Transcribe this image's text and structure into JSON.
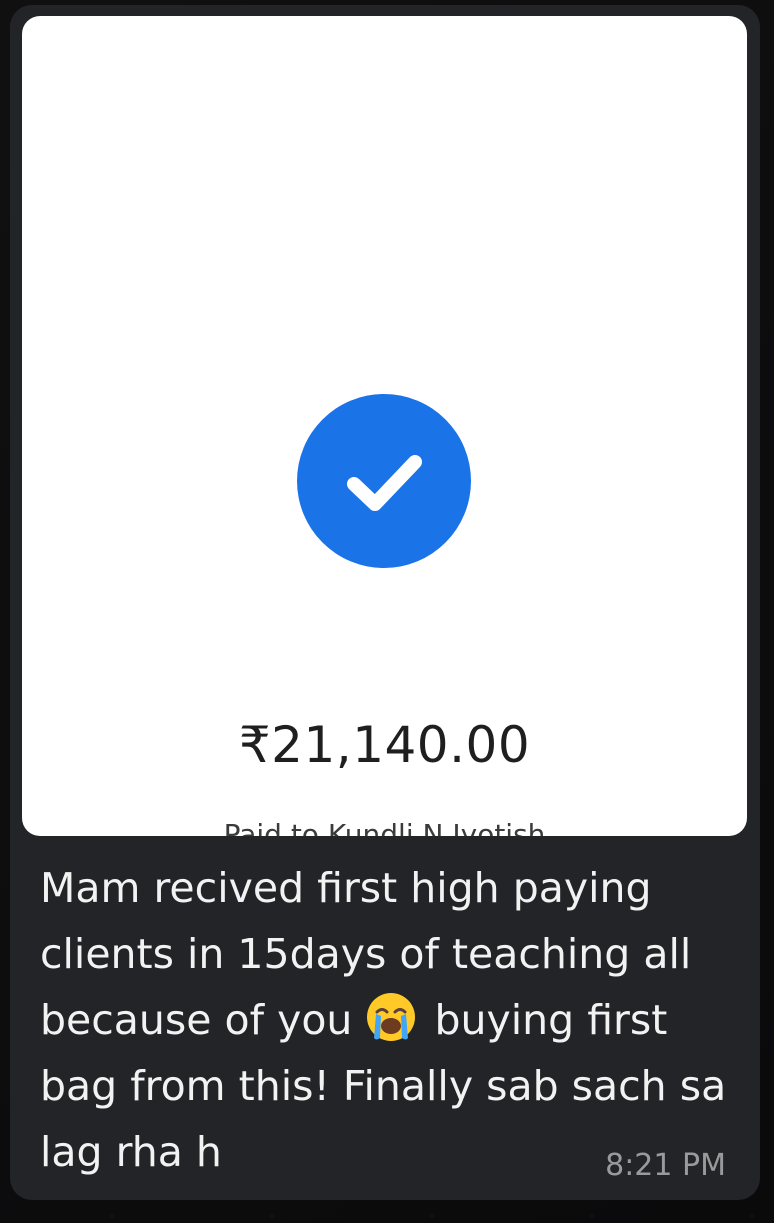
{
  "payment": {
    "amount": "₹21,140.00",
    "paid_to": "Paid to Kundli N Jyotish",
    "status_icon": "check-circle-icon",
    "accent_color": "#1b73e8"
  },
  "message": {
    "text_part1": "Mam recived first high paying clients in 15days of teaching all because of you",
    "emoji": "loudly-crying-face-emoji",
    "text_part2": " buying first bag from this! Finally sab sach sa lag rha h",
    "time": "8:21 PM"
  }
}
